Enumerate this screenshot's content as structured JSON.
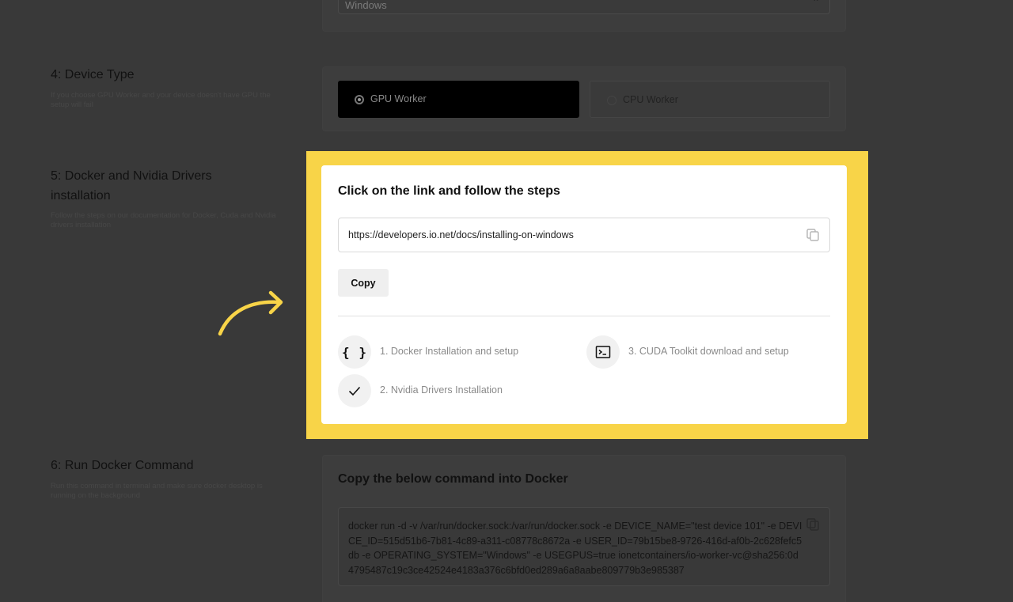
{
  "os_select": {
    "value": "Windows"
  },
  "sections": {
    "device_type": {
      "title": "4: Device Type",
      "desc": "If you choose GPU Worker and your device doesn't have GPU the setup will fail",
      "gpu_label": "GPU Worker",
      "cpu_label": "CPU Worker",
      "selected": "GPU Worker"
    },
    "docker": {
      "title": "5: Docker and Nvidia Drivers installation",
      "desc": "Follow the steps on our documentation for Docker, Cuda and Nvidia drivers installation"
    },
    "run": {
      "title": "6: Run Docker Command",
      "desc": "Run this command in terminal and make sure docker desktop is running on the background"
    }
  },
  "card": {
    "title": "Click on the link and follow the steps",
    "url": "https://developers.io.net/docs/installing-on-windows",
    "copy_label": "Copy",
    "steps": [
      {
        "label": "1. Docker Installation and setup",
        "icon": "braces-icon"
      },
      {
        "label": "2. Nvidia Drivers Installation",
        "icon": "check-icon"
      },
      {
        "label": "3. CUDA Toolkit download and setup",
        "icon": "terminal-icon"
      }
    ]
  },
  "command": {
    "title": "Copy the below command into Docker",
    "text": "docker run -d -v /var/run/docker.sock:/var/run/docker.sock -e DEVICE_NAME=\"test device 101\" -e DEVICE_ID=515d51b6-7b81-4c89-a311-c08778c8672a -e USER_ID=79b15be8-9726-416d-af0b-2c628fefc5db -e OPERATING_SYSTEM=\"Windows\" -e USEGPUS=true ionetcontainers/io-worker-vc@sha256:0d4795487c19c3ce42524e4183a376c6bfd0ed289a6a8aabe809779b3e985387"
  },
  "colors": {
    "highlight": "#f8d448",
    "overlay": "#393939"
  }
}
